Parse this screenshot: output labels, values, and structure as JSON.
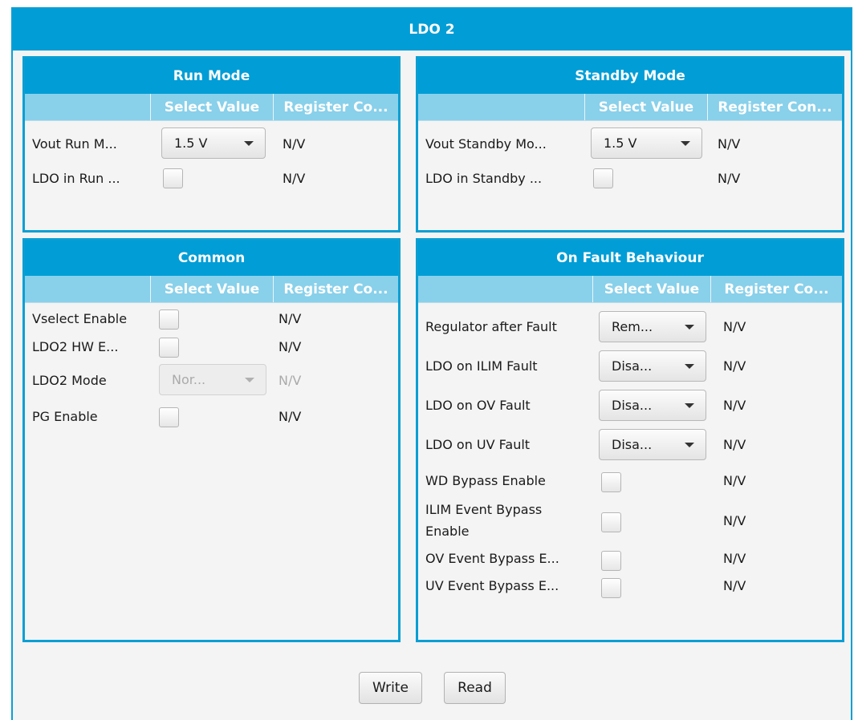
{
  "window": {
    "title": "LDO 2"
  },
  "run_mode": {
    "title": "Run Mode",
    "headers": [
      "",
      "Select Value",
      "Register Co..."
    ],
    "rows": [
      {
        "label": "Vout Run M...",
        "type": "combo",
        "value": "1.5 V",
        "register": "N/V"
      },
      {
        "label": "LDO in Run ...",
        "type": "checkbox",
        "checked": false,
        "register": "N/V"
      }
    ]
  },
  "standby_mode": {
    "title": "Standby Mode",
    "headers": [
      "",
      "Select Value",
      "Register Con..."
    ],
    "rows": [
      {
        "label": "Vout Standby Mo...",
        "type": "combo",
        "value": "1.5 V",
        "register": "N/V"
      },
      {
        "label": "LDO in Standby ...",
        "type": "checkbox",
        "checked": false,
        "register": "N/V"
      }
    ]
  },
  "common": {
    "title": "Common",
    "headers": [
      "",
      "Select Value",
      "Register Co..."
    ],
    "rows": [
      {
        "label": "Vselect Enable",
        "type": "checkbox",
        "checked": false,
        "register": "N/V"
      },
      {
        "label": "LDO2 HW E...",
        "type": "checkbox",
        "checked": false,
        "register": "N/V"
      },
      {
        "label": "LDO2 Mode",
        "type": "combo",
        "value": "Nor...",
        "disabled": true,
        "register": "N/V"
      },
      {
        "label": "PG Enable",
        "type": "checkbox",
        "checked": false,
        "register": "N/V"
      }
    ]
  },
  "on_fault": {
    "title": "On Fault Behaviour",
    "headers": [
      "",
      "Select Value",
      "Register Co..."
    ],
    "rows": [
      {
        "label": "Regulator after Fault",
        "type": "combo",
        "value": "Rem...",
        "register": "N/V"
      },
      {
        "label": "LDO on ILIM Fault",
        "type": "combo",
        "value": "Disa...",
        "register": "N/V"
      },
      {
        "label": "LDO on OV Fault",
        "type": "combo",
        "value": "Disa...",
        "register": "N/V"
      },
      {
        "label": "LDO on UV Fault",
        "type": "combo",
        "value": "Disa...",
        "register": "N/V"
      },
      {
        "label": "WD Bypass Enable",
        "type": "checkbox",
        "checked": false,
        "register": "N/V"
      },
      {
        "label_line1": "ILIM Event Bypass",
        "label_line2": "Enable",
        "type": "checkbox",
        "checked": false,
        "register": "N/V"
      },
      {
        "label": "OV Event Bypass E...",
        "type": "checkbox",
        "checked": false,
        "register": "N/V"
      },
      {
        "label": "UV Event Bypass E...",
        "type": "checkbox",
        "checked": false,
        "register": "N/V"
      }
    ]
  },
  "footer": {
    "write_label": "Write",
    "read_label": "Read"
  },
  "colors": {
    "accent": "#009dd6",
    "header_light": "#89d0ea",
    "panel_bg": "#f4f4f4"
  },
  "icons": {
    "combo_arrow": "chevron-down-icon"
  }
}
